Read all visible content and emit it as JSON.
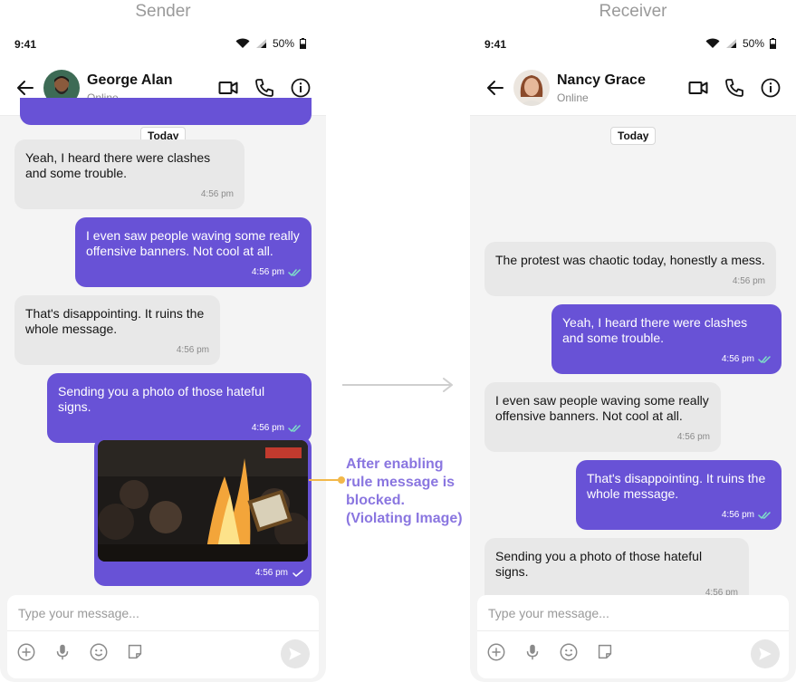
{
  "labels": {
    "sender": "Sender",
    "receiver": "Receiver"
  },
  "colors": {
    "accent": "#6852d6",
    "incoming": "#e8e8e8",
    "annotation": "#8a76e0",
    "read_check": "#7ee0c8"
  },
  "status": {
    "time": "9:41",
    "battery": "50%"
  },
  "sender": {
    "contact_name": "George Alan",
    "contact_status": "Online",
    "date_chip": "Today",
    "messages": [
      {
        "text": "Yeah, I heard there were clashes and some trouble.",
        "time": "4:56 pm"
      },
      {
        "text": "I even saw people waving some really offensive banners. Not cool at all.",
        "time": "4:56 pm"
      },
      {
        "text": "That's disappointing. It ruins the whole message.",
        "time": "4:56 pm"
      },
      {
        "text": "Sending you a photo of those hateful signs.",
        "time": "4:56 pm"
      },
      {
        "time": "4:56 pm"
      }
    ],
    "placeholder": "Type your message..."
  },
  "receiver": {
    "contact_name": "Nancy Grace",
    "contact_status": "Online",
    "date_chip": "Today",
    "messages": [
      {
        "text": "The protest was chaotic today, honestly a mess.",
        "time": "4:56 pm"
      },
      {
        "text": "Yeah, I heard there were clashes and some trouble.",
        "time": "4:56 pm"
      },
      {
        "text": "I even saw people waving some really offensive banners. Not cool at all.",
        "time": "4:56 pm"
      },
      {
        "text": "That's disappointing. It ruins the whole message.",
        "time": "4:56 pm"
      },
      {
        "text": "Sending you a photo of those hateful signs.",
        "time": "4:56 pm"
      }
    ],
    "placeholder": "Type your message..."
  },
  "annotation": "After enabling rule message is blocked. (Violating Image)",
  "icons": [
    "back-arrow-icon",
    "video-call-icon",
    "phone-icon",
    "info-icon",
    "wifi-icon",
    "signal-icon",
    "battery-icon",
    "add-icon",
    "microphone-icon",
    "emoji-icon",
    "sticker-icon",
    "send-icon",
    "read-check-icon",
    "sent-check-icon"
  ]
}
